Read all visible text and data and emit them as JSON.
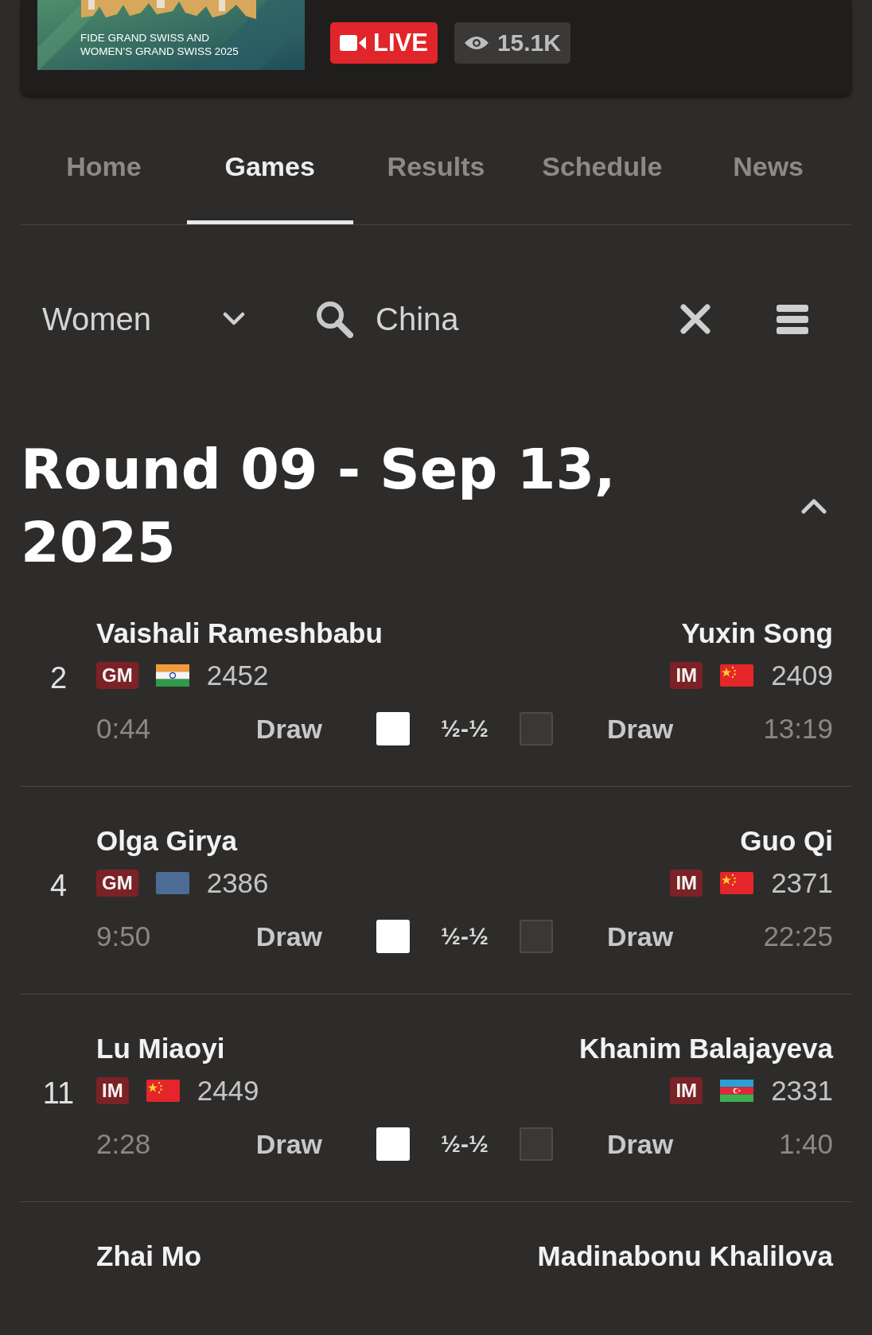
{
  "banner": {
    "kind": "picture",
    "title_lines": [
      "FIDE GRAND SWISS AND",
      "WOMEN’S GRAND SWISS 2025"
    ]
  },
  "live_badge": "LIVE",
  "viewers": "15.1K",
  "tabs": [
    {
      "label": "Home",
      "selected": false
    },
    {
      "label": "Games",
      "selected": true
    },
    {
      "label": "Results",
      "selected": false
    },
    {
      "label": "Schedule",
      "selected": false
    },
    {
      "label": "News",
      "selected": false
    }
  ],
  "filters": {
    "section": "Women",
    "search": "China"
  },
  "round": {
    "title": "Round 09 - Sep 13, 2025",
    "expanded": true
  },
  "games": [
    {
      "board": "2",
      "white": {
        "name": "Vaishali Rameshbabu",
        "title": "GM",
        "flag": {
          "kind": "india"
        },
        "rating": "2452",
        "clock": "0:44",
        "status": "Draw"
      },
      "result": "½-½",
      "black": {
        "name": "Yuxin Song",
        "title": "IM",
        "flag": {
          "kind": "china"
        },
        "rating": "2409",
        "clock": "13:19",
        "status": "Draw"
      }
    },
    {
      "board": "4",
      "white": {
        "name": "Olga Girya",
        "title": "GM",
        "flag": {
          "kind": "neutral"
        },
        "rating": "2386",
        "clock": "9:50",
        "status": "Draw"
      },
      "result": "½-½",
      "black": {
        "name": "Guo Qi",
        "title": "IM",
        "flag": {
          "kind": "china"
        },
        "rating": "2371",
        "clock": "22:25",
        "status": "Draw"
      }
    },
    {
      "board": "11",
      "white": {
        "name": "Lu Miaoyi",
        "title": "IM",
        "flag": {
          "kind": "china"
        },
        "rating": "2449",
        "clock": "2:28",
        "status": "Draw"
      },
      "result": "½-½",
      "black": {
        "name": "Khanim Balajayeva",
        "title": "IM",
        "flag": {
          "kind": "azerbaijan"
        },
        "rating": "2331",
        "clock": "1:40",
        "status": "Draw"
      }
    },
    {
      "white": {
        "name": "Zhai Mo"
      },
      "black": {
        "name": "Madinabonu Khalilova"
      }
    }
  ]
}
